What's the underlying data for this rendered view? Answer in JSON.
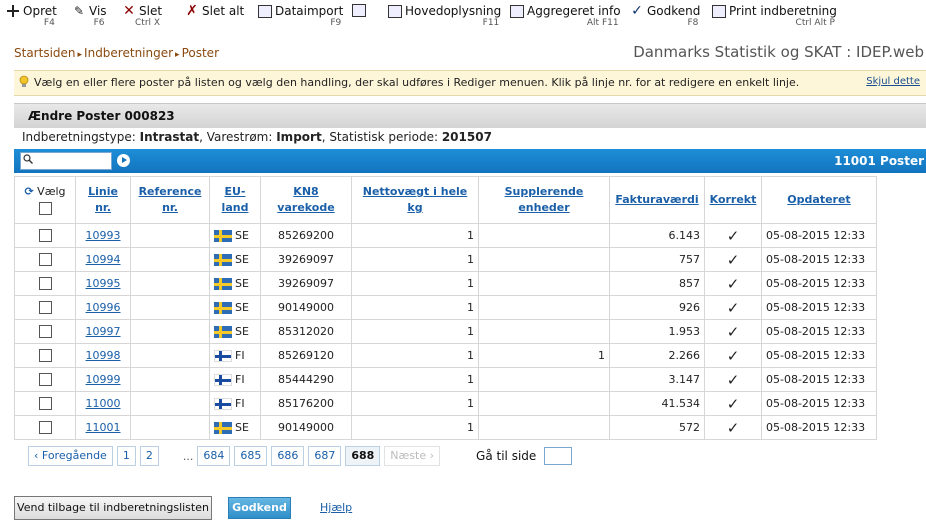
{
  "toolbar": {
    "items": [
      {
        "label": "Opret",
        "key": "F4",
        "icon": "plus-icon"
      },
      {
        "label": "Vis",
        "key": "F6",
        "icon": "pencil-icon"
      },
      {
        "label": "Slet",
        "key": "Ctrl X",
        "icon": "delete-x-icon"
      },
      {
        "label": "Slet alt",
        "key": "",
        "icon": "delete-all-icon"
      },
      {
        "label": "Dataimport",
        "key": "F9",
        "icon": "import-icon"
      },
      {
        "label": "",
        "key": "",
        "icon": "copy-icon"
      },
      {
        "label": "Hovedoplysning",
        "key": "F11",
        "icon": "main-info-icon"
      },
      {
        "label": "Aggregeret info",
        "key": "Alt F11",
        "icon": "aggregate-icon"
      },
      {
        "label": "Godkend",
        "key": "F8",
        "icon": "checkmark-icon"
      },
      {
        "label": "Print indberetning",
        "key": "Ctrl Alt P",
        "icon": "printer-icon"
      }
    ]
  },
  "breadcrumb": [
    "Startsiden",
    "Indberetninger",
    "Poster"
  ],
  "app_title": "Danmarks Statistik og SKAT : IDEP.web",
  "info": {
    "message": "Vælg en eller flere poster på listen og vælg den handling, der skal udføres i Rediger menuen. Klik på linje nr. for at redigere en enkelt linje.",
    "hide_link": "Skjul dette"
  },
  "section_title": "Ændre Poster 000823",
  "meta": {
    "type_label": "Indberetningstype:",
    "type_value": "Intrastat",
    "flow_label": ", Varestrøm:",
    "flow_value": "Import",
    "period_label": ", Statistisk periode:",
    "period_value": "201507"
  },
  "search": {
    "placeholder": "",
    "count": "11001 Poster"
  },
  "table": {
    "headers": {
      "select": "Vælg",
      "line": "Linie nr.",
      "reference": "Reference nr.",
      "country": "EU-land",
      "kn8": "KN8 varekode",
      "weight": "Nettovægt i hele kg",
      "supp": "Supplerende enheder",
      "invoice": "Fakturaværdi",
      "correct": "Korrekt",
      "updated": "Opdateret"
    },
    "rows": [
      {
        "line": "10993",
        "reference": "",
        "country": "SE",
        "kn8": "85269200",
        "weight": "1",
        "supp": "",
        "invoice": "6.143",
        "correct": "✓",
        "updated": "05-08-2015 12:33"
      },
      {
        "line": "10994",
        "reference": "",
        "country": "SE",
        "kn8": "39269097",
        "weight": "1",
        "supp": "",
        "invoice": "757",
        "correct": "✓",
        "updated": "05-08-2015 12:33"
      },
      {
        "line": "10995",
        "reference": "",
        "country": "SE",
        "kn8": "39269097",
        "weight": "1",
        "supp": "",
        "invoice": "857",
        "correct": "✓",
        "updated": "05-08-2015 12:33"
      },
      {
        "line": "10996",
        "reference": "",
        "country": "SE",
        "kn8": "90149000",
        "weight": "1",
        "supp": "",
        "invoice": "926",
        "correct": "✓",
        "updated": "05-08-2015 12:33"
      },
      {
        "line": "10997",
        "reference": "",
        "country": "SE",
        "kn8": "85312020",
        "weight": "1",
        "supp": "",
        "invoice": "1.953",
        "correct": "✓",
        "updated": "05-08-2015 12:33"
      },
      {
        "line": "10998",
        "reference": "",
        "country": "FI",
        "kn8": "85269120",
        "weight": "1",
        "supp": "1",
        "invoice": "2.266",
        "correct": "✓",
        "updated": "05-08-2015 12:33"
      },
      {
        "line": "10999",
        "reference": "",
        "country": "FI",
        "kn8": "85444290",
        "weight": "1",
        "supp": "",
        "invoice": "3.147",
        "correct": "✓",
        "updated": "05-08-2015 12:33"
      },
      {
        "line": "11000",
        "reference": "",
        "country": "FI",
        "kn8": "85176200",
        "weight": "1",
        "supp": "",
        "invoice": "41.534",
        "correct": "✓",
        "updated": "05-08-2015 12:33"
      },
      {
        "line": "11001",
        "reference": "",
        "country": "SE",
        "kn8": "90149000",
        "weight": "1",
        "supp": "",
        "invoice": "572",
        "correct": "✓",
        "updated": "05-08-2015 12:33"
      }
    ]
  },
  "pager": {
    "prev": "‹ Foregående",
    "pages": [
      "1",
      "2",
      "...",
      "684",
      "685",
      "686",
      "687",
      "688"
    ],
    "current": "688",
    "next": "Næste ›",
    "goto_label": "Gå til side"
  },
  "footer": {
    "back_button": "Vend tilbage til indberetningslisten",
    "approve_button": "Godkend",
    "help_link": "Hjælp"
  }
}
